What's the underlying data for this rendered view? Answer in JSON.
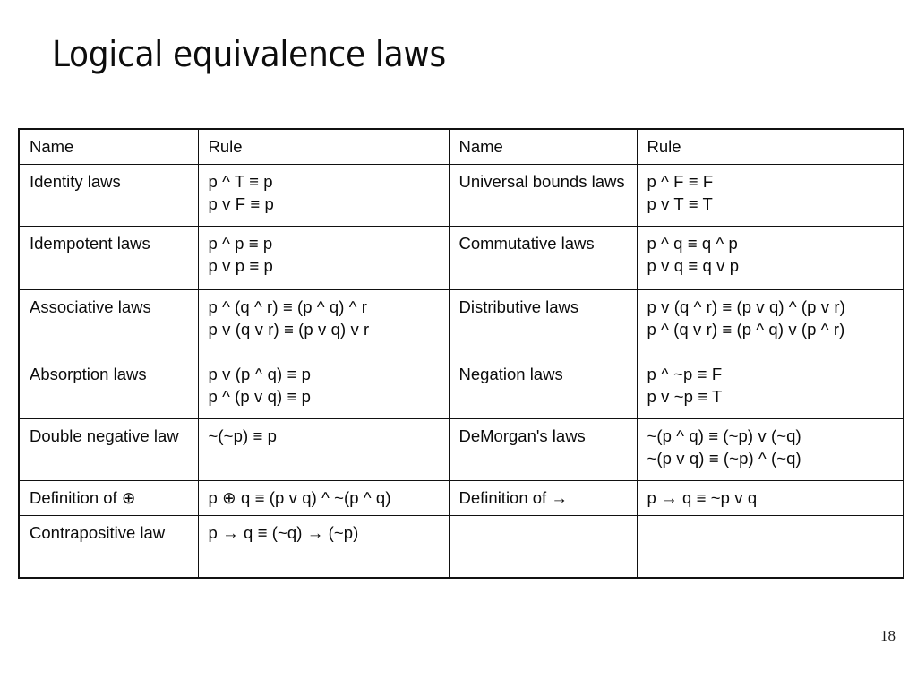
{
  "slide": {
    "title": "Logical equivalence laws",
    "page_number": "18"
  },
  "table": {
    "headers": {
      "name_left": "Name",
      "rule_left": "Rule",
      "name_right": "Name",
      "rule_right": "Rule"
    },
    "rows": [
      {
        "left_name": "Identity laws",
        "left_rule_1": "p ^ T ≡ p",
        "left_rule_2": "p v F ≡ p",
        "right_name": "Universal bounds laws",
        "right_rule_1": "p ^ F ≡ F",
        "right_rule_2": "p v T ≡ T"
      },
      {
        "left_name": "Idempotent laws",
        "left_rule_1": "p ^ p ≡ p",
        "left_rule_2": "p v p ≡ p",
        "right_name": "Commutative laws",
        "right_rule_1": "p ^ q ≡ q ^ p",
        "right_rule_2": "p v q ≡ q v p"
      },
      {
        "left_name": "Associative laws",
        "left_rule_1": "p ^ (q ^ r) ≡ (p ^ q) ^ r",
        "left_rule_2": "p v (q v r) ≡ (p v q) v r",
        "right_name": "Distributive laws",
        "right_rule_1": "p v (q ^ r) ≡ (p v q) ^ (p v r)",
        "right_rule_2": "p ^ (q v r) ≡ (p ^ q) v (p ^ r)"
      },
      {
        "left_name": "Absorption laws",
        "left_rule_1": "p v (p ^ q) ≡ p",
        "left_rule_2": "p ^ (p v q) ≡ p",
        "right_name": "Negation laws",
        "right_rule_1": "p ^ ~p ≡ F",
        "right_rule_2": "p v ~p ≡ T"
      },
      {
        "left_name": "Double negative law",
        "left_rule_1": "~(~p) ≡ p",
        "left_rule_2": "",
        "right_name": "DeMorgan's laws",
        "right_rule_1": "~(p ^ q) ≡ (~p) v (~q)",
        "right_rule_2": "~(p v q) ≡ (~p) ^ (~q)"
      },
      {
        "left_name": "Definition of ⊕",
        "left_rule_1": "p ⊕ q ≡ (p v q) ^ ~(p ^ q)",
        "left_rule_2": "",
        "right_name": "Definition of →",
        "right_rule_1": "p → q ≡ ~p v q",
        "right_rule_2": ""
      },
      {
        "left_name": "Contrapositive law",
        "left_rule_1": "p → q ≡ (~q) → (~p)",
        "left_rule_2": "",
        "right_name": "",
        "right_rule_1": "",
        "right_rule_2": ""
      }
    ]
  },
  "colors": {
    "background": "#ffffff",
    "text": "#0b0b0b",
    "border": "#111111"
  }
}
